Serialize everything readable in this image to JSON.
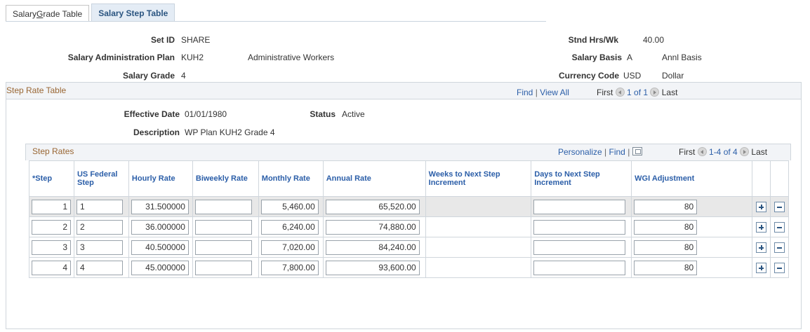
{
  "tabs": [
    {
      "label_prefix": "Salary ",
      "label_accel": "G",
      "label_suffix": "rade Table"
    },
    {
      "label": "Salary Step Table"
    }
  ],
  "header": {
    "setid_label": "Set ID",
    "setid_value": "SHARE",
    "plan_label": "Salary Administration Plan",
    "plan_value": "KUH2",
    "plan_desc": "Administrative Workers",
    "grade_label": "Salary Grade",
    "grade_value": "4",
    "hours_label": "Stnd Hrs/Wk",
    "hours_value": "40.00",
    "basis_label": "Salary Basis",
    "basis_value": "A",
    "basis_desc": "Annl Basis",
    "currency_label": "Currency Code",
    "currency_value": "USD",
    "currency_desc": "Dollar"
  },
  "step_rate_table": {
    "title": "Step Rate Table",
    "find": "Find",
    "sep": "|",
    "view_all": "View All",
    "first": "First",
    "range": "1 of 1",
    "last": "Last",
    "effdt_label": "Effective Date",
    "effdt_value": "01/01/1980",
    "status_label": "Status",
    "status_value": "Active",
    "descr_label": "Description",
    "descr_value": "WP Plan KUH2 Grade 4"
  },
  "step_rates": {
    "title": "Step Rates",
    "personalize": "Personalize",
    "sep": "|",
    "find": "Find",
    "sep2": "|",
    "first": "First",
    "range": "1-4 of 4",
    "last": "Last",
    "columns": [
      "*Step",
      "US Federal Step",
      "Hourly Rate",
      "Biweekly Rate",
      "Monthly Rate",
      "Annual Rate",
      "Weeks to Next Step Increment",
      "Days to Next Step Increment",
      "WGI Adjustment"
    ],
    "rows": [
      {
        "step": "1",
        "fed_step": "1",
        "hourly": "31.500000",
        "biweekly": "",
        "monthly": "5,460.00",
        "annual": "65,520.00",
        "days": "",
        "wgi": "80"
      },
      {
        "step": "2",
        "fed_step": "2",
        "hourly": "36.000000",
        "biweekly": "",
        "monthly": "6,240.00",
        "annual": "74,880.00",
        "days": "",
        "wgi": "80"
      },
      {
        "step": "3",
        "fed_step": "3",
        "hourly": "40.500000",
        "biweekly": "",
        "monthly": "7,020.00",
        "annual": "84,240.00",
        "days": "",
        "wgi": "80"
      },
      {
        "step": "4",
        "fed_step": "4",
        "hourly": "45.000000",
        "biweekly": "",
        "monthly": "7,800.00",
        "annual": "93,600.00",
        "days": "",
        "wgi": "80"
      }
    ]
  }
}
